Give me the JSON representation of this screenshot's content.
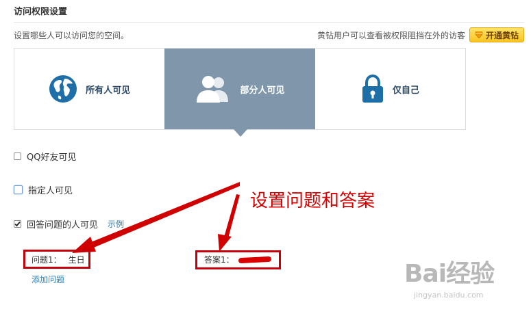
{
  "page": {
    "title": "访问权限设置",
    "description": "设置哪些人可以访问您的空间。",
    "vip_notice": "黄钻用户可以查看被权限阻挡在外的访客",
    "vip_button": "开通黄钻"
  },
  "tabs": [
    {
      "label": "所有人可见",
      "icon": "globe-icon",
      "active": false
    },
    {
      "label": "部分人可见",
      "icon": "users-icon",
      "active": true
    },
    {
      "label": "仅自己",
      "icon": "lock-icon",
      "active": false
    }
  ],
  "options": [
    {
      "label": "QQ好友可见",
      "checked": false
    },
    {
      "label": "指定人可见",
      "checked": false
    },
    {
      "label": "回答问题的人可见",
      "checked": true,
      "link": "示例"
    }
  ],
  "questions": {
    "question_label": "问题1：",
    "question_value": "生日",
    "answer_label": "答案1：",
    "add_link": "添加问题"
  },
  "annotation": "设置问题和答案",
  "watermark": {
    "brand": "Bai经验",
    "url": "jingyan.baidu.com"
  },
  "colors": {
    "active_tab": "#7f96ab",
    "tab_text": "#2e4a66",
    "link": "#2f7db6",
    "annotation_red": "#c4000a",
    "vip_yellow": "#f7c520"
  }
}
